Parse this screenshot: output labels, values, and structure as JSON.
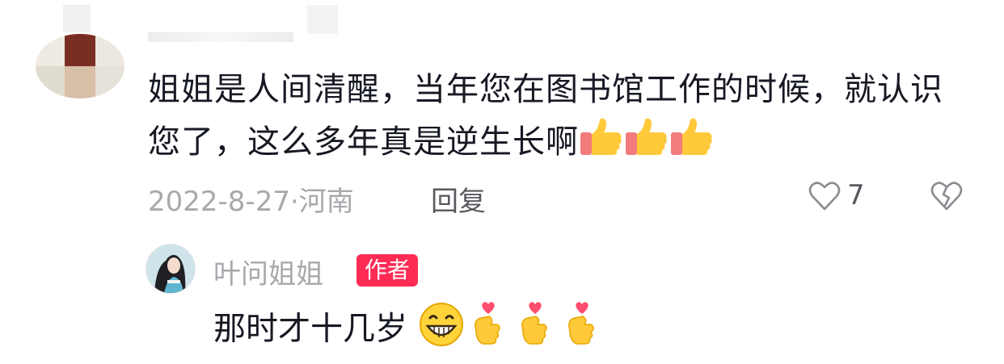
{
  "comment": {
    "text": "姐姐是人间清醒，当年您在图书馆工作的时候，就认识您了，这么多年真是逆生长啊",
    "emojis": [
      "thumbs-up",
      "thumbs-up",
      "thumbs-up"
    ],
    "date_location": "2022-8-27·河南",
    "reply_label": "回复",
    "like_count": "7"
  },
  "reply": {
    "author_name": "叶问姐姐",
    "author_badge": "作者",
    "text": "那时才十几岁",
    "emojis": [
      "grinning-face",
      "heart-hands",
      "heart-hands",
      "heart-hands"
    ]
  },
  "colors": {
    "text": "#161823",
    "meta": "#a8a8ad",
    "secondary": "#58585f",
    "badge": "#fe2c55"
  },
  "icons": [
    "heart-outline-icon",
    "broken-heart-icon"
  ]
}
